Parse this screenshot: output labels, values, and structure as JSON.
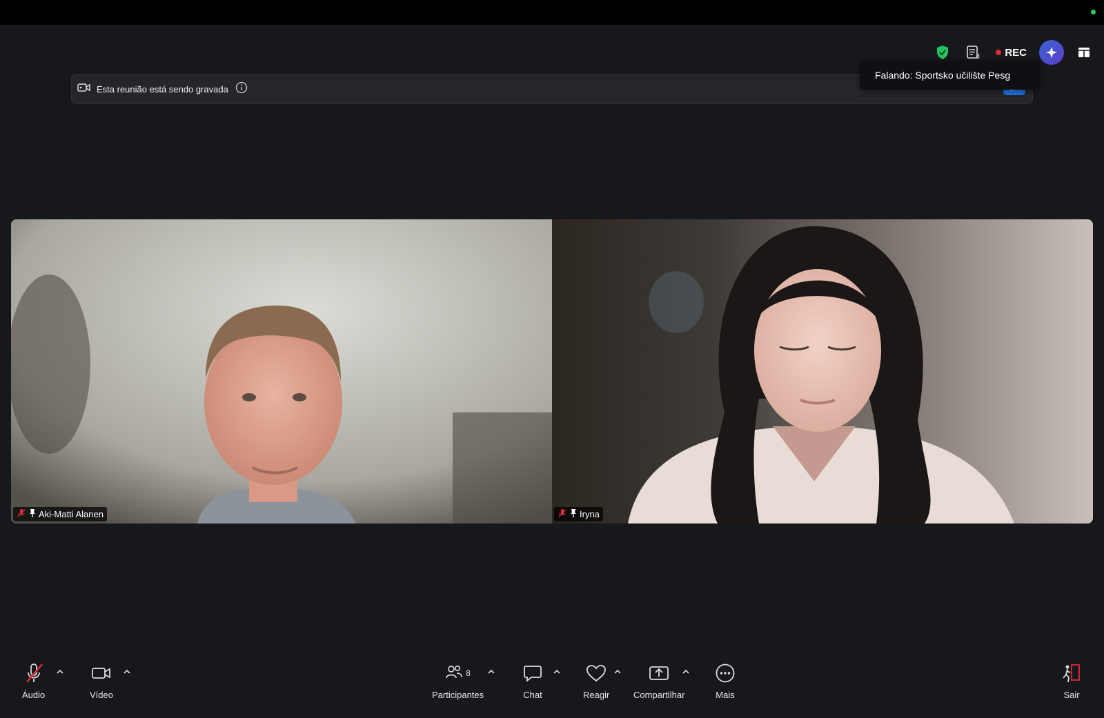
{
  "window": {
    "status_color": "#2ecc51"
  },
  "top_icons": {
    "shield_color": "#23c45e",
    "rec_label": "REC"
  },
  "banner": {
    "text": "Esta reunião está sendo gravada",
    "ok_label": "OK"
  },
  "tooltip": {
    "text": "Falando: Sportsko učilište Pesg"
  },
  "participants": [
    {
      "name": "Aki-Matti Alanen",
      "muted": true,
      "pinned": true
    },
    {
      "name": "Iryna",
      "muted": true,
      "pinned": true
    }
  ],
  "toolbar": {
    "audio_label": "Áudio",
    "video_label": "Vídeo",
    "participants_label": "Participantes",
    "participants_count": "8",
    "chat_label": "Chat",
    "react_label": "Reagir",
    "share_label": "Compartilhar",
    "more_label": "Mais",
    "leave_label": "Sair"
  },
  "colors": {
    "accent_blue": "#1d6fe0",
    "danger_red": "#e02b39",
    "background": "#17181c"
  }
}
